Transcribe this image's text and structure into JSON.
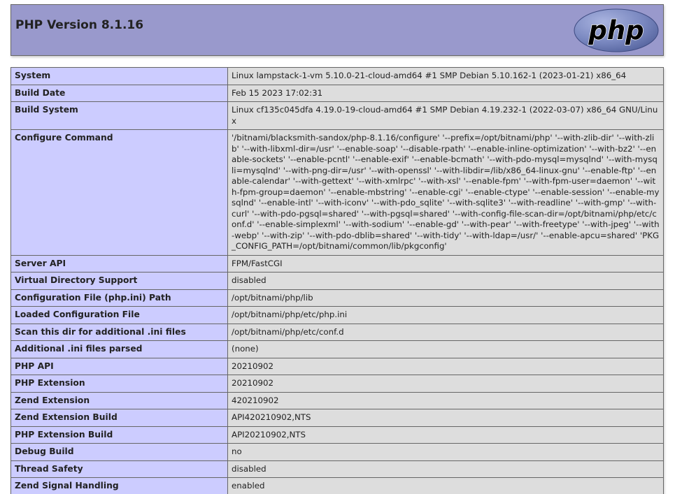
{
  "header": {
    "title": "PHP Version 8.1.16",
    "logo_text": "php"
  },
  "rows": [
    {
      "label": "System",
      "value": "Linux lampstack-1-vm 5.10.0-21-cloud-amd64 #1 SMP Debian 5.10.162-1 (2023-01-21) x86_64"
    },
    {
      "label": "Build Date",
      "value": "Feb 15 2023 17:02:31"
    },
    {
      "label": "Build System",
      "value": "Linux cf135c045dfa 4.19.0-19-cloud-amd64 #1 SMP Debian 4.19.232-1 (2022-03-07) x86_64 GNU/Linux"
    },
    {
      "label": "Configure Command",
      "value": "'/bitnami/blacksmith-sandox/php-8.1.16/configure' '--prefix=/opt/bitnami/php' '--with-zlib-dir' '--with-zlib' '--with-libxml-dir=/usr' '--enable-soap' '--disable-rpath' '--enable-inline-optimization' '--with-bz2' '--enable-sockets' '--enable-pcntl' '--enable-exif' '--enable-bcmath' '--with-pdo-mysql=mysqlnd' '--with-mysqli=mysqlnd' '--with-png-dir=/usr' '--with-openssl' '--with-libdir=/lib/x86_64-linux-gnu' '--enable-ftp' '--enable-calendar' '--with-gettext' '--with-xmlrpc' '--with-xsl' '--enable-fpm' '--with-fpm-user=daemon' '--with-fpm-group=daemon' '--enable-mbstring' '--enable-cgi' '--enable-ctype' '--enable-session' '--enable-mysqlnd' '--enable-intl' '--with-iconv' '--with-pdo_sqlite' '--with-sqlite3' '--with-readline' '--with-gmp' '--with-curl' '--with-pdo-pgsql=shared' '--with-pgsql=shared' '--with-config-file-scan-dir=/opt/bitnami/php/etc/conf.d' '--enable-simplexml' '--with-sodium' '--enable-gd' '--with-pear' '--with-freetype' '--with-jpeg' '--with-webp' '--with-zip' '--with-pdo-dblib=shared' '--with-tidy' '--with-ldap=/usr/' '--enable-apcu=shared' 'PKG_CONFIG_PATH=/opt/bitnami/common/lib/pkgconfig'"
    },
    {
      "label": "Server API",
      "value": "FPM/FastCGI"
    },
    {
      "label": "Virtual Directory Support",
      "value": "disabled"
    },
    {
      "label": "Configuration File (php.ini) Path",
      "value": "/opt/bitnami/php/lib"
    },
    {
      "label": "Loaded Configuration File",
      "value": "/opt/bitnami/php/etc/php.ini"
    },
    {
      "label": "Scan this dir for additional .ini files",
      "value": "/opt/bitnami/php/etc/conf.d"
    },
    {
      "label": "Additional .ini files parsed",
      "value": "(none)"
    },
    {
      "label": "PHP API",
      "value": "20210902"
    },
    {
      "label": "PHP Extension",
      "value": "20210902"
    },
    {
      "label": "Zend Extension",
      "value": "420210902"
    },
    {
      "label": "Zend Extension Build",
      "value": "API420210902,NTS"
    },
    {
      "label": "PHP Extension Build",
      "value": "API20210902,NTS"
    },
    {
      "label": "Debug Build",
      "value": "no"
    },
    {
      "label": "Thread Safety",
      "value": "disabled"
    },
    {
      "label": "Zend Signal Handling",
      "value": "enabled"
    }
  ],
  "colors": {
    "header_bg": "#9999cc",
    "label_bg": "#ccccff",
    "value_bg": "#dddddd",
    "border": "#666666",
    "logo_fill": "#6c7eb7",
    "logo_text": "#000000"
  }
}
